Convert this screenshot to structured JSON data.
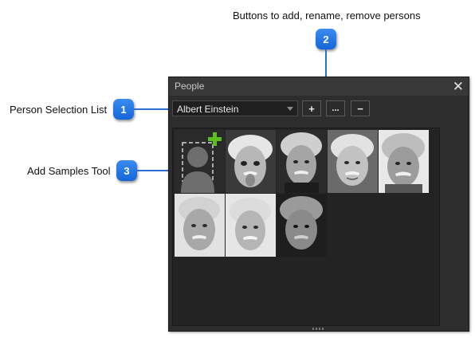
{
  "callouts": {
    "buttons": {
      "number": "2",
      "text": "Buttons to add, rename, remove persons"
    },
    "person_list": {
      "number": "1",
      "text": "Person Selection List"
    },
    "samples": {
      "number": "3",
      "text": "Add Samples Tool"
    }
  },
  "panel": {
    "title": "People",
    "close_glyph": "✕",
    "person_select": {
      "value": "Albert Einstein"
    },
    "buttons": [
      {
        "label": "+",
        "icon": "plus-icon"
      },
      {
        "label": "...",
        "icon": "ellipsis-icon"
      },
      {
        "label": "−",
        "icon": "minus-icon"
      }
    ],
    "sample_count": 8
  },
  "colors": {
    "callout_badge": "#1e78e8",
    "panel_bg": "#2d2d2d",
    "add_accent": "#5bbf1f"
  }
}
